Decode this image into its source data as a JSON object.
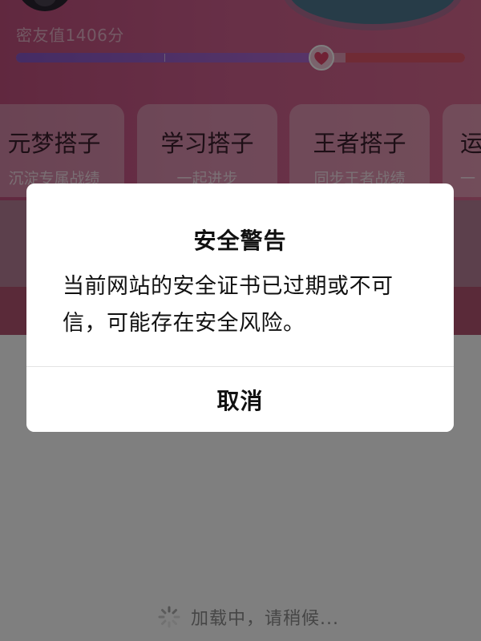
{
  "app": {
    "score_text": "密友值1406分",
    "progress_fraction": 0.68,
    "cards": [
      {
        "title": "元梦搭子",
        "subtitle": "沉淀专属战绩"
      },
      {
        "title": "学习搭子",
        "subtitle": "一起进步"
      },
      {
        "title": "王者搭子",
        "subtitle": "同步王者战绩"
      },
      {
        "title": "运",
        "subtitle": "一"
      }
    ],
    "loading_text": "加载中，请稍候..."
  },
  "dialog": {
    "title": "安全警告",
    "message": "当前网站的安全证书已过期或不可信，可能存在安全风险。",
    "cancel_label": "取消"
  },
  "colors": {
    "overlay": "#000000",
    "dialog_bg": "#ffffff",
    "app_gradient_start": "#c2517f",
    "progress_fill": "#8a58c8",
    "progress_rest": "#e0566a"
  }
}
